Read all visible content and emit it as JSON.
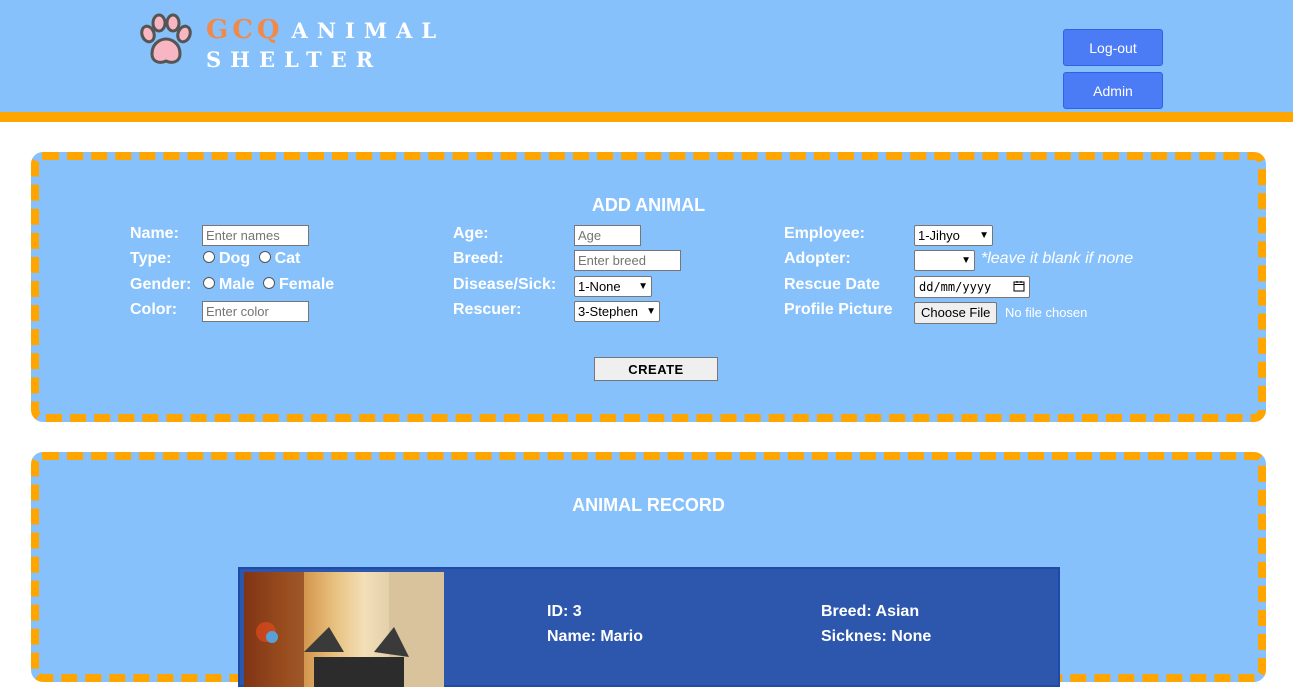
{
  "header": {
    "brand_line1_prefix": "GCQ",
    "brand_line1": "ANIMAL",
    "brand_line2": "SHELTER",
    "logout_label": "Log-out",
    "admin_label": "Admin"
  },
  "add_animal": {
    "title": "ADD ANIMAL",
    "name_label": "Name:",
    "name_placeholder": "Enter names",
    "type_label": "Type:",
    "type_option_dog": "Dog",
    "type_option_cat": "Cat",
    "gender_label": "Gender:",
    "gender_option_male": "Male",
    "gender_option_female": "Female",
    "color_label": "Color:",
    "color_placeholder": "Enter color",
    "age_label": "Age:",
    "age_placeholder": "Age",
    "breed_label": "Breed:",
    "breed_placeholder": "Enter breed",
    "disease_label": "Disease/Sick:",
    "disease_value": "1-None",
    "rescuer_label": "Rescuer:",
    "rescuer_value": "3-Stephen",
    "employee_label": "Employee:",
    "employee_value": "1-Jihyo",
    "adopter_label": "Adopter:",
    "adopter_value": "",
    "adopter_hint": "*leave it blank if none",
    "rescue_date_label": "Rescue Date",
    "rescue_date_value": "dd/mm/yyyy",
    "profile_picture_label": "Profile Picture",
    "choose_file_label": "Choose File",
    "file_status": "No file chosen",
    "create_label": "CREATE"
  },
  "animal_record": {
    "title": "ANIMAL RECORD",
    "id_text": "ID: 3",
    "name_text": "Name: Mario",
    "breed_text": "Breed: Asian",
    "sickness_text": "Sicknes: None"
  },
  "colors": {
    "header_bg": "#87c1fb",
    "accent_orange": "#ffa500",
    "button_blue": "#4b7cf6",
    "record_card_bg": "#2c57ad",
    "brand_prefix": "#f08a4b"
  },
  "icons": {
    "logo": "paw-icon",
    "calendar": "calendar-icon",
    "caret": "chevron-down-icon"
  }
}
